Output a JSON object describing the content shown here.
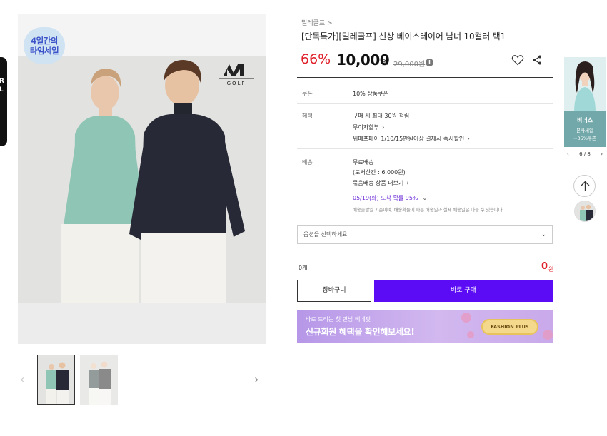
{
  "left_banner": {
    "text_lines": [
      "R",
      "L"
    ]
  },
  "image": {
    "badge_lines": [
      "4일간의",
      "타임세일"
    ],
    "logo_text": "GOLF"
  },
  "breadcrumb": "밀레골프 >",
  "product": {
    "title": "[단독특가][밀레골프] 신상 베이스레이어 남녀 10컬러 택1",
    "discount": "66%",
    "sale_price": "10,000",
    "won": "원",
    "original_price": "29,000원"
  },
  "details": {
    "coupon": {
      "label": "쿠폰",
      "value": "10% 상품쿠폰"
    },
    "benefit": {
      "label": "혜택",
      "lines": [
        "구매 시 최대 30원 적립",
        "무이자할부",
        "위메프페이 1/10/15만원이상 결제시 즉시할인"
      ]
    },
    "shipping": {
      "label": "배송",
      "lines": [
        "무료배송",
        "(도서산간 : 6,000원)",
        "묶음배송 상품 더보기"
      ],
      "arrival": "05/19(화) 도착 확률 95%",
      "note": "배송출발일 기준이며, 배송확률에 따른 배송일과 실제 배송일은 다를 수 있습니다"
    }
  },
  "option": {
    "placeholder": "옵션을 선택하세요"
  },
  "summary": {
    "quantity": "0개",
    "total": "0",
    "total_won": "원"
  },
  "buttons": {
    "cart": "장바구니",
    "buy": "바로 구매"
  },
  "promo": {
    "small": "바로 드리는 첫 만남 베네핏",
    "big": "신규회원 혜택을 확인해보세요!",
    "logo": "FASHION PLUS"
  },
  "rail": {
    "ad_title": "비너스",
    "ad_line2": "본사세일",
    "ad_line3": "~35%쿠폰",
    "pager": "6 / 8"
  },
  "colors": {
    "accent_purple": "#5b0cf5",
    "discount_red": "#e0202a",
    "rail_teal": "#72a8a9"
  }
}
